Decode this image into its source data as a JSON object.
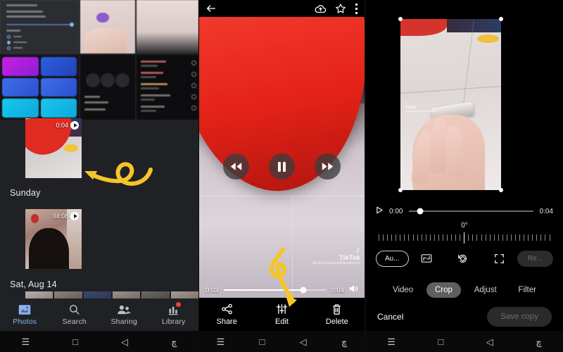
{
  "panels": {
    "left": {
      "name": "Google Photos library"
    },
    "mid": {
      "name": "Google Photos video player"
    },
    "right": {
      "name": "Google Photos video crop editor"
    }
  },
  "photos_app": {
    "day_labels": [
      "Sunday",
      "Sat, Aug 14"
    ],
    "thumbnails": [
      {
        "duration": "0:04",
        "play_icon": "play-icon"
      },
      {
        "duration": "04:08",
        "play_icon": "play-icon"
      }
    ],
    "nav": [
      {
        "label": "Photos",
        "icon": "photos-icon",
        "active": true,
        "badge": ""
      },
      {
        "label": "Search",
        "icon": "search-icon",
        "active": false,
        "badge": ""
      },
      {
        "label": "Sharing",
        "icon": "sharing-icon",
        "active": false,
        "badge": ""
      },
      {
        "label": "Library",
        "icon": "library-icon",
        "active": false,
        "badge": "1"
      }
    ],
    "accent_color": "#8ab4f8",
    "badge_color": "#e8453c",
    "background_color": "#202124"
  },
  "player": {
    "topbar": [
      {
        "icon": "back-arrow-icon"
      },
      {
        "icon": "cloud-upload-icon"
      },
      {
        "icon": "star-icon"
      },
      {
        "icon": "more-vert-icon"
      }
    ],
    "controls": [
      {
        "icon": "rewind-icon"
      },
      {
        "icon": "pause-icon"
      },
      {
        "icon": "fast-forward-icon"
      }
    ],
    "seek": {
      "current_time": "0:03",
      "total_time": "0:04",
      "progress_percent": 78,
      "volume_icon": "volume-icon"
    },
    "watermark": {
      "note_icon": "music-note-icon",
      "brand": "TikTok",
      "username": "@carlojoannavledespinoza"
    },
    "actions": [
      {
        "label": "Share",
        "icon": "share-icon"
      },
      {
        "label": "Edit",
        "icon": "edit-sliders-icon"
      },
      {
        "label": "Delete",
        "icon": "trash-icon"
      }
    ]
  },
  "editor": {
    "seek": {
      "current_time": "0:00",
      "total_time": "0:04",
      "play_icon": "play-icon",
      "progress_percent": 9
    },
    "rotation_label": "0°",
    "tools": [
      {
        "label": "Au...",
        "name": "auto-button",
        "style": "outlined"
      },
      {
        "label": "",
        "name": "aspect-ratio-icon",
        "style": "icon"
      },
      {
        "label": "",
        "name": "rotate-icon",
        "style": "icon"
      },
      {
        "label": "",
        "name": "expand-icon",
        "style": "icon"
      },
      {
        "label": "Re...",
        "name": "reset-button",
        "style": "disabled"
      }
    ],
    "tabs": [
      {
        "label": "Video",
        "active": false
      },
      {
        "label": "Crop",
        "active": true
      },
      {
        "label": "Adjust",
        "active": false
      },
      {
        "label": "Filter",
        "active": false
      }
    ],
    "cancel_label": "Cancel",
    "save_label": "Save copy",
    "watermark": {
      "brand": "TikTok",
      "username": "@carlojoannavledespinoza"
    }
  },
  "system_nav": {
    "icons": [
      "menu-icon",
      "home-square-icon",
      "back-triangle-icon",
      "accessibility-icon"
    ],
    "glyphs": [
      "☰",
      "□",
      "◁",
      "ڇ"
    ]
  },
  "annotations": {
    "color": "#f5c528",
    "arrow_left": "curved arrow with loop pointing at the 0:04 video thumbnail",
    "arrow_mid": "curved arrow with loop pointing down at the Edit button"
  }
}
